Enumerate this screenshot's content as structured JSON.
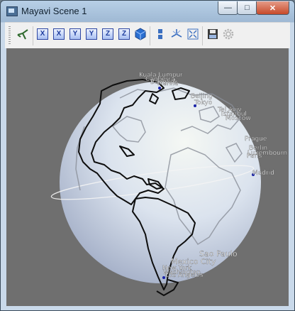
{
  "window": {
    "title": "Mayavi Scene 1"
  },
  "titlebar_buttons": {
    "minimize": "—",
    "maximize": "□",
    "close": "✕"
  },
  "toolbar": {
    "buttons": [
      {
        "name": "mayavi-pipeline-button",
        "icon": "mayavi-logo-icon"
      },
      {
        "name": "view-x-minus-button",
        "label": "X"
      },
      {
        "name": "view-x-plus-button",
        "label": "X"
      },
      {
        "name": "view-y-minus-button",
        "label": "Y"
      },
      {
        "name": "view-y-plus-button",
        "label": "Y"
      },
      {
        "name": "view-z-minus-button",
        "label": "Z"
      },
      {
        "name": "view-z-plus-button",
        "label": "Z"
      },
      {
        "name": "isometric-view-button",
        "icon": "cube-icon"
      },
      {
        "name": "parallel-projection-button",
        "icon": "parallel-icon"
      },
      {
        "name": "toggle-axes-button",
        "icon": "axes-icon"
      },
      {
        "name": "fullscreen-button",
        "icon": "fullscreen-icon"
      },
      {
        "name": "save-button",
        "icon": "floppy-disk-icon"
      },
      {
        "name": "settings-button",
        "icon": "gear-icon"
      }
    ]
  },
  "scene": {
    "cities": [
      {
        "label": "Kuala Lumpur"
      },
      {
        "label": "Canberra"
      },
      {
        "label": "Bangkok"
      },
      {
        "label": "Manila"
      },
      {
        "label": "Beijing"
      },
      {
        "label": "Tokyo"
      },
      {
        "label": "Tel Aviv"
      },
      {
        "label": "Istanbul"
      },
      {
        "label": "Moscow"
      },
      {
        "label": "Paris"
      },
      {
        "label": "Berlin"
      },
      {
        "label": "Prague"
      },
      {
        "label": "Luxembourn"
      },
      {
        "label": "Madrid"
      },
      {
        "label": "Sao Paulo"
      },
      {
        "label": "Mexico City"
      },
      {
        "label": "New York"
      },
      {
        "label": "Washington"
      },
      {
        "label": "Los Angeles"
      }
    ]
  }
}
